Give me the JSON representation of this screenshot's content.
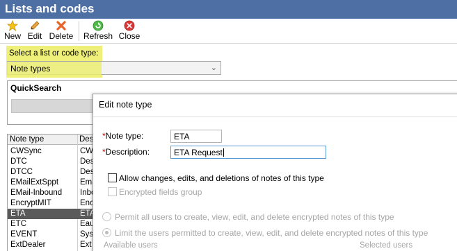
{
  "window": {
    "title": "Lists and codes"
  },
  "toolbar": {
    "buttons": [
      {
        "label": "New",
        "icon": "star-icon"
      },
      {
        "label": "Edit",
        "icon": "pencil-icon"
      },
      {
        "label": "Delete",
        "icon": "delete-x-icon"
      },
      {
        "label": "Refresh",
        "icon": "refresh-icon"
      },
      {
        "label": "Close",
        "icon": "close-icon"
      }
    ]
  },
  "list_type": {
    "label": "Select a list or code type:",
    "selected": "Note types"
  },
  "quick_search": {
    "title": "QuickSearch"
  },
  "grid": {
    "columns": [
      "Note type",
      "Desc"
    ],
    "rows": [
      {
        "name": "CWSync",
        "desc": "CW"
      },
      {
        "name": "DTC",
        "desc": "Des"
      },
      {
        "name": "DTCC",
        "desc": "Des"
      },
      {
        "name": "EMailExtSppt",
        "desc": "Ema"
      },
      {
        "name": "EMail-Inbound",
        "desc": "Inbo"
      },
      {
        "name": "EncryptMIT",
        "desc": "Encr"
      },
      {
        "name": "ETA",
        "desc": "ETA"
      },
      {
        "name": "ETC",
        "desc": "Eau"
      },
      {
        "name": "EVENT",
        "desc": "Sys"
      },
      {
        "name": "ExtDealer",
        "desc": "Ext"
      }
    ],
    "selected_index": 6
  },
  "dialog": {
    "title": "Edit note type",
    "note_type_label": "Note type:",
    "note_type_value": "ETA",
    "description_label": "Description:",
    "description_value": "ETA Request",
    "allow_changes_label": "Allow changes, edits, and deletions of notes of this type",
    "encrypted_group_label": "Encrypted fields group",
    "permit_all_label": "Permit all users to create, view, edit, and delete encrypted notes of this type",
    "limit_users_label": "Limit the users permitted to create, view, edit, and delete encrypted notes of this type",
    "available_users_label": "Available users",
    "selected_users_label": "Selected users"
  },
  "colors": {
    "titlebar": "#4d6fa3",
    "highlight": "#eef07a",
    "selected_row": "#5a5a5a",
    "required": "#c00000"
  }
}
